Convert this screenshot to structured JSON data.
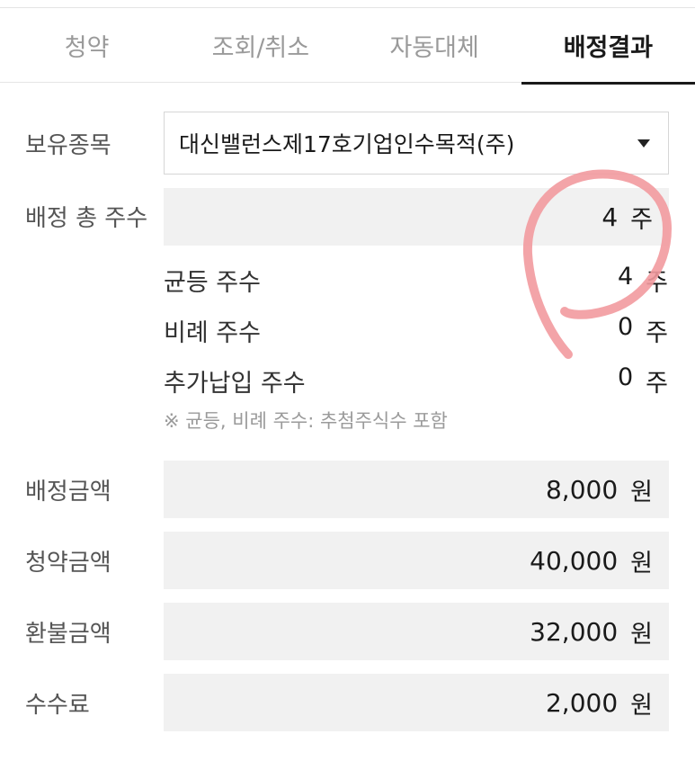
{
  "tabs": [
    {
      "label": "청약",
      "active": false
    },
    {
      "label": "조회/취소",
      "active": false
    },
    {
      "label": "자동대체",
      "active": false
    },
    {
      "label": "배정결과",
      "active": true
    }
  ],
  "holding": {
    "label": "보유종목",
    "selected": "대신밸런스제17호기업인수목적(주)",
    "icon": "caret-down-icon"
  },
  "allocation_total": {
    "label": "배정 총 주수",
    "value": "4",
    "unit": "주"
  },
  "breakdown": {
    "equal": {
      "label": "균등 주수",
      "value": "4",
      "unit": "주"
    },
    "proportional": {
      "label": "비례 주수",
      "value": "0",
      "unit": "주"
    },
    "additional": {
      "label": "추가납입 주수",
      "value": "0",
      "unit": "주"
    },
    "note": "※ 균등, 비례 주수: 추첨주식수 포함"
  },
  "amounts": {
    "allocated": {
      "label": "배정금액",
      "value": "8,000",
      "unit": "원"
    },
    "subscribed": {
      "label": "청약금액",
      "value": "40,000",
      "unit": "원"
    },
    "refund": {
      "label": "환불금액",
      "value": "32,000",
      "unit": "원"
    },
    "fee": {
      "label": "수수료",
      "value": "2,000",
      "unit": "원"
    }
  },
  "colors": {
    "annotation_stroke": "#f29a9f",
    "box_background": "#f1f1f1",
    "active_tab": "#1a1a1a",
    "inactive_tab": "#9a9a9a"
  }
}
